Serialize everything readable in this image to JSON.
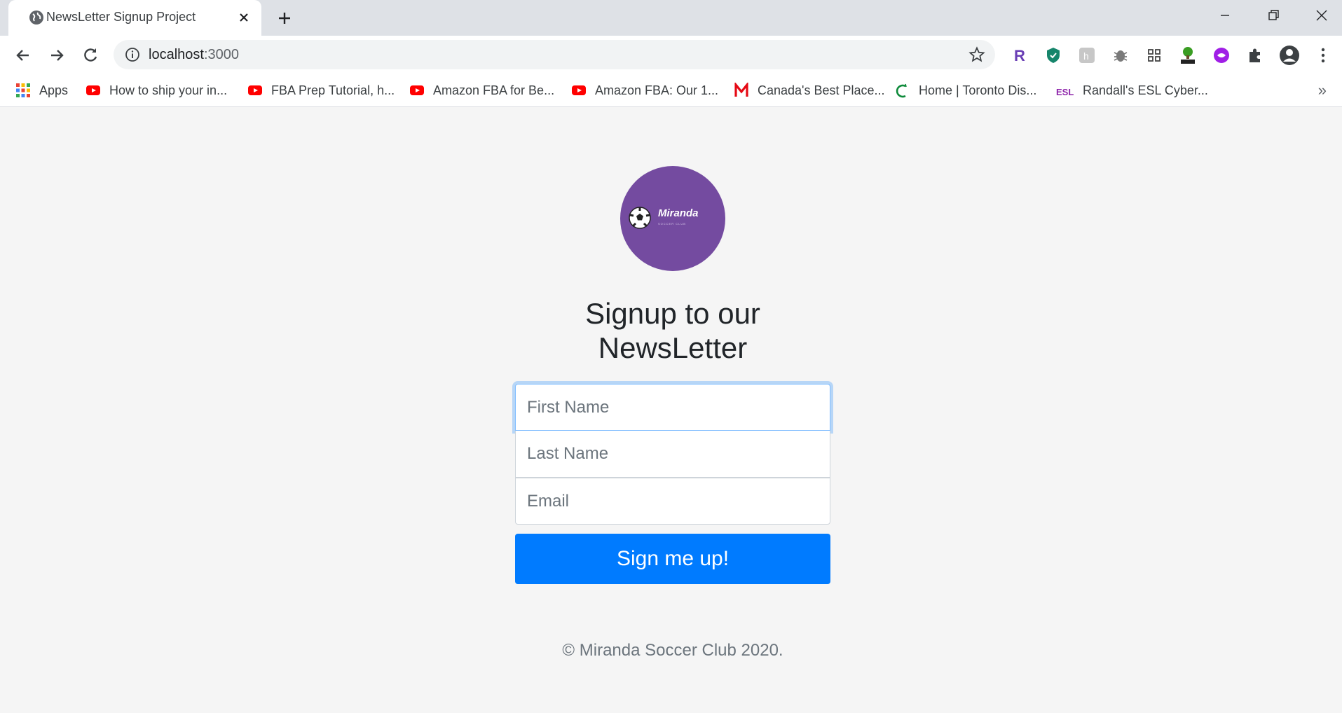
{
  "browser": {
    "tab_title": "NewsLetter Signup Project",
    "url_host": "localhost",
    "url_port": ":3000",
    "bookmarks": [
      {
        "label": "Apps",
        "icon": "apps-grid-icon"
      },
      {
        "label": "How to ship your in...",
        "icon": "youtube-icon"
      },
      {
        "label": "FBA Prep Tutorial, h...",
        "icon": "youtube-icon"
      },
      {
        "label": "Amazon FBA for Be...",
        "icon": "youtube-icon"
      },
      {
        "label": "Amazon FBA: Our 1...",
        "icon": "youtube-icon"
      },
      {
        "label": "Canada's Best Place...",
        "icon": "m-logo-icon"
      },
      {
        "label": "Home | Toronto Dis...",
        "icon": "tdsb-icon"
      },
      {
        "label": "Randall's ESL Cyber...",
        "icon": "esl-icon"
      }
    ],
    "more_bookmarks": "»"
  },
  "page": {
    "logo": {
      "brand": "Miranda",
      "tagline": "SOCCER CLUB"
    },
    "heading": "Signup to our NewsLetter",
    "form": {
      "first_name_placeholder": "First Name",
      "last_name_placeholder": "Last Name",
      "email_placeholder": "Email",
      "submit_label": "Sign me up!"
    },
    "footer": "© Miranda Soccer Club 2020."
  },
  "colors": {
    "primary_button": "#007bff",
    "logo_circle": "#744ba0",
    "page_background": "#f5f5f5"
  }
}
